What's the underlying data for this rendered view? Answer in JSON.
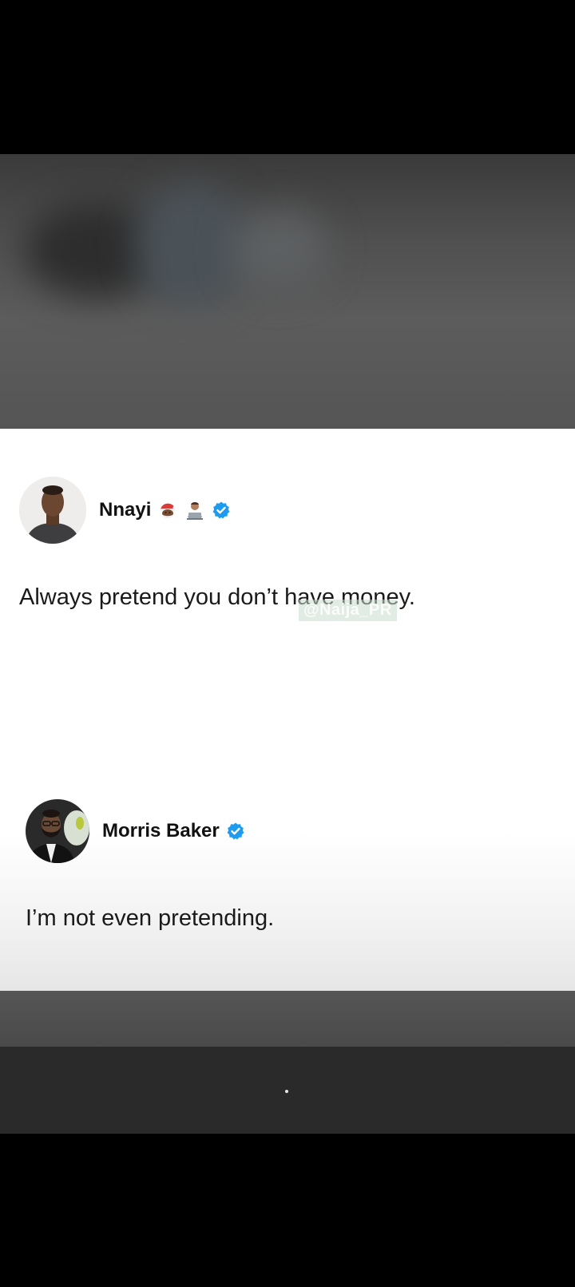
{
  "posts": [
    {
      "author": "Nnayi",
      "badges": [
        "santa-emoji",
        "person-at-laptop-emoji",
        "verified-badge-icon"
      ],
      "text": "Always pretend you don’t have money."
    },
    {
      "author": "Morris Baker",
      "badges": [
        "verified-badge-icon"
      ],
      "text": "I’m not even pretending."
    }
  ],
  "watermark": "@Naija_PR",
  "colors": {
    "verified": "#1d9bf0",
    "text": "#1a1a1a",
    "card_background": "#ffffff"
  }
}
